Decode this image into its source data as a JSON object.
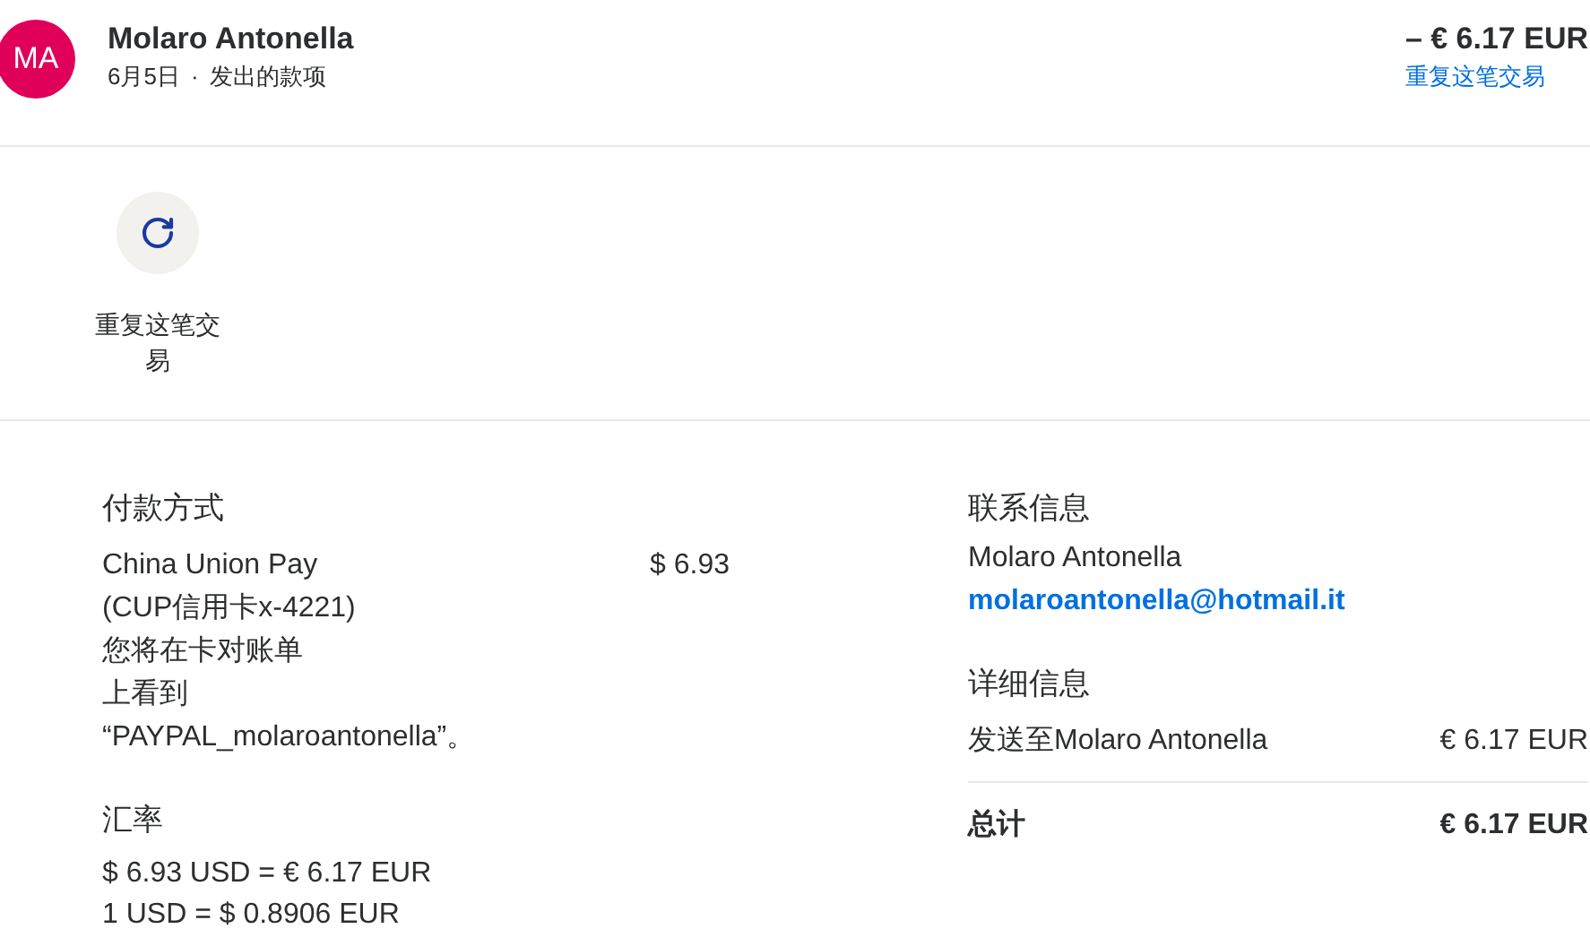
{
  "header": {
    "avatar": "MA",
    "name": "Molaro Antonella",
    "date": "6月5日",
    "separator": "·",
    "type": "发出的款项",
    "amount": "– € 6.17 EUR",
    "repeat_link": "重复这笔交易"
  },
  "actions": [
    {
      "label": "重复这笔交易"
    }
  ],
  "payment": {
    "heading": "付款方式",
    "method": "China Union Pay",
    "card": "(CUP信用卡x-4221)",
    "note_lines": [
      "您将在卡对账单",
      "上看到",
      "“PAYPAL_molaroantonella”。"
    ],
    "amount": "$ 6.93"
  },
  "exchange": {
    "heading": "汇率",
    "lines": [
      "$ 6.93 USD = € 6.17 EUR",
      "1 USD = $ 0.8906 EUR"
    ]
  },
  "contact": {
    "heading": "联系信息",
    "name": "Molaro Antonella",
    "email": "molaroantonella@hotmail.it"
  },
  "details": {
    "heading": "详细信息",
    "rows": [
      {
        "label": "发送至Molaro Antonella",
        "value": "€ 6.17 EUR",
        "kind": "item"
      },
      {
        "label": "总计",
        "value": "€ 6.17 EUR",
        "kind": "total"
      }
    ]
  }
}
